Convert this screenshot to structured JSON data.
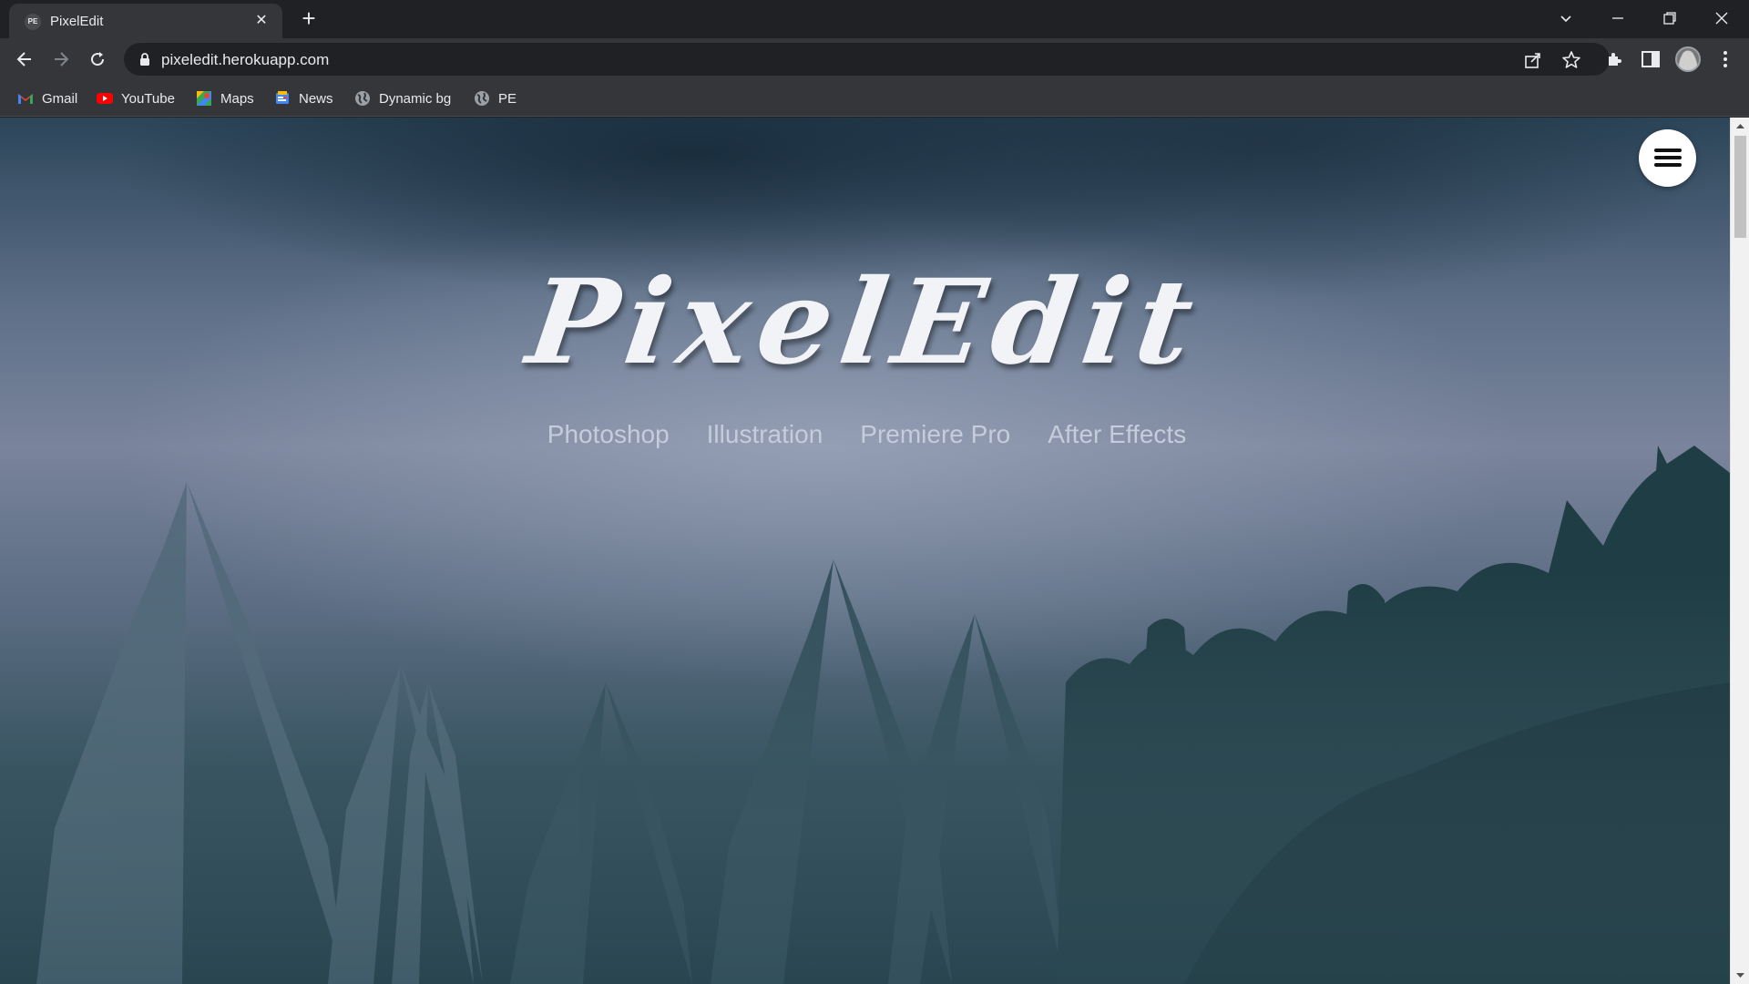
{
  "browser": {
    "tab": {
      "title": "PixelEdit",
      "favicon_text": "PE",
      "close_glyph": "✕"
    },
    "new_tab_glyph": "+",
    "address_bar": {
      "url": "pixeledit.herokuapp.com"
    },
    "bookmarks": [
      {
        "label": "Gmail",
        "icon": "gmail-icon"
      },
      {
        "label": "YouTube",
        "icon": "youtube-icon"
      },
      {
        "label": "Maps",
        "icon": "maps-icon"
      },
      {
        "label": "News",
        "icon": "news-icon"
      },
      {
        "label": "Dynamic bg",
        "icon": "globe-icon"
      },
      {
        "label": "PE",
        "icon": "globe-icon"
      }
    ]
  },
  "page": {
    "title": "PixelEdit",
    "nav": [
      "Photoshop",
      "Illustration",
      "Premiere Pro",
      "After Effects"
    ]
  },
  "colors": {
    "chrome_dark": "#202124",
    "chrome_toolbar": "#35363a",
    "title_text": "#f2f3f7",
    "nav_text": "#c5ccdc"
  }
}
